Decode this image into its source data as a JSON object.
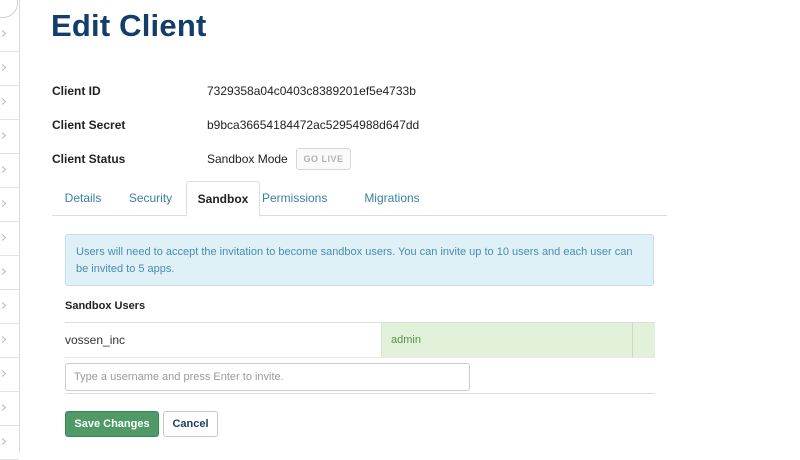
{
  "page": {
    "title": "Edit Client"
  },
  "client": {
    "id_label": "Client ID",
    "id_value": "7329358a04c0403c8389201ef5e4733b",
    "secret_label": "Client Secret",
    "secret_value": "b9bca36654184472ac52954988d647dd",
    "status_label": "Client Status",
    "status_value": "Sandbox Mode",
    "go_live_label": "GO LIVE"
  },
  "tabs": [
    {
      "label": "Details",
      "active": false
    },
    {
      "label": "Security",
      "active": false
    },
    {
      "label": "Sandbox",
      "active": true
    },
    {
      "label": "Permissions",
      "active": false
    },
    {
      "label": "Migrations",
      "active": false
    }
  ],
  "sandbox": {
    "info_text": "Users will need to accept the invitation to become sandbox users. You can invite up to 10 users and each user can be invited to 5 apps.",
    "section_title": "Sandbox Users",
    "users": [
      {
        "username": "vossen_inc",
        "role": "admin"
      }
    ],
    "invite_placeholder": "Type a username and press Enter to invite."
  },
  "actions": {
    "save_label": "Save Changes",
    "cancel_label": "Cancel"
  },
  "colors": {
    "title": "#133d6b",
    "tab_link": "#3a7fa8",
    "info_bg": "#dff0f7",
    "role_bg": "#e2f1d9",
    "save_button": "#4f9a66"
  },
  "icons": {
    "rail_items": "chevron-right-icon"
  }
}
